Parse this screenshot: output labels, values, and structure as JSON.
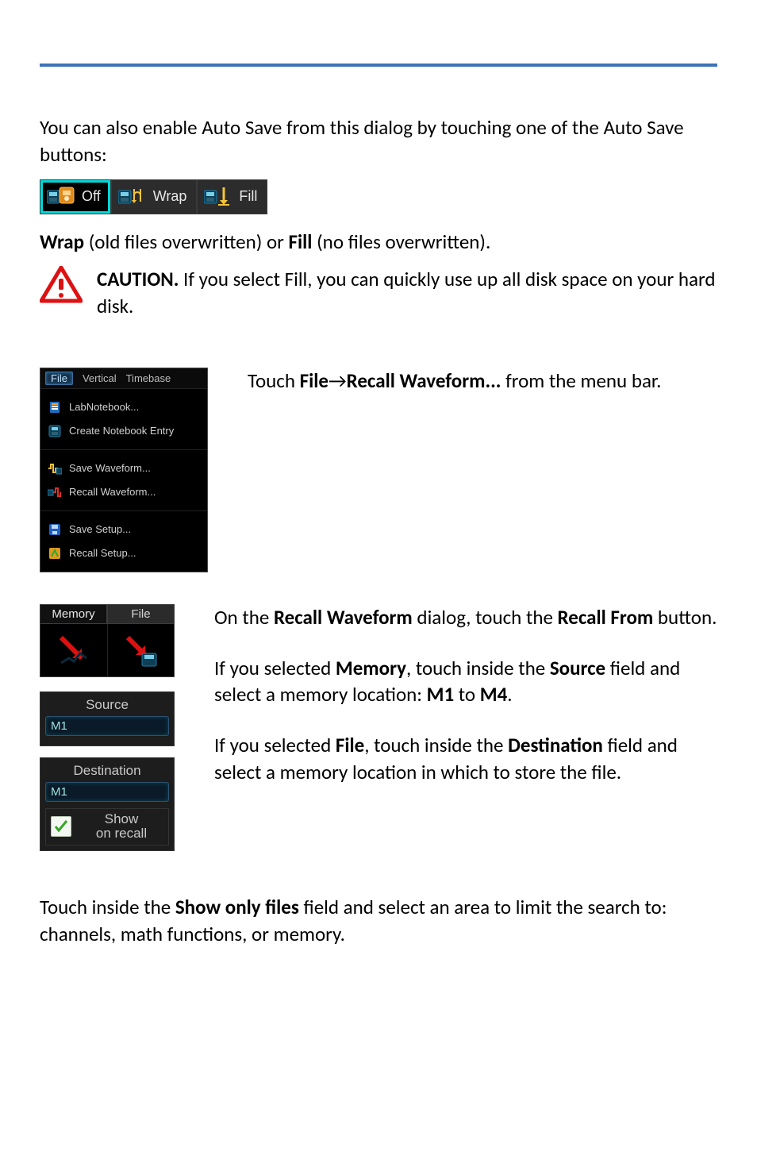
{
  "intro": "You can also enable Auto Save from this dialog by touching one of the Auto Save buttons:",
  "autosave": {
    "off": "Off",
    "wrap": "Wrap",
    "fill": "Fill"
  },
  "wrap_line": {
    "wrap": "Wrap",
    "wrap_desc": " (old files overwritten) or ",
    "fill": "Fill",
    "fill_desc": " (no files overwritten)."
  },
  "caution": {
    "label": "CAUTION.",
    "text": " If you select Fill, you can quickly use up all disk space on your hard disk."
  },
  "step1": {
    "prefix": "Touch ",
    "file": "File",
    "arrow": " → ",
    "recall": "Recall Waveform...",
    "suffix": " from the menu bar."
  },
  "filemenu": {
    "menubar": {
      "file": "File",
      "vertical": "Vertical",
      "timebase": "Timebase"
    },
    "labnotebook": "LabNotebook...",
    "create_entry": "Create Notebook Entry",
    "save_wave": "Save Waveform...",
    "recall_wave": "Recall Waveform...",
    "save_setup": "Save Setup...",
    "recall_setup": "Recall Setup..."
  },
  "step2": {
    "p1a": "On the ",
    "p1b": "Recall Waveform",
    "p1c": " dialog, touch the ",
    "p1d": "Recall From",
    "p1e": " button.",
    "p2a": "If you selected ",
    "p2b": "Memory",
    "p2c": ", touch inside the ",
    "p2d": "Source",
    "p2e": " field and select a memory location: ",
    "p2f": "M1",
    "p2g": " to ",
    "p2h": "M4",
    "p2i": ".",
    "p3a": "If you selected ",
    "p3b": "File",
    "p3c": ", touch inside the ",
    "p3d": "Destination",
    "p3e": " field and select a memory location in which to store the file."
  },
  "recallfrom": {
    "memory": "Memory",
    "file": "File"
  },
  "sd": {
    "source_title": "Source",
    "source_value": "M1",
    "dest_title": "Destination",
    "dest_value": "M1",
    "show_line1": "Show",
    "show_line2": "on recall"
  },
  "closing": {
    "a": "Touch inside the ",
    "b": "Show only files",
    "c": " field and select an area to limit the search to: channels, math functions, or memory."
  }
}
